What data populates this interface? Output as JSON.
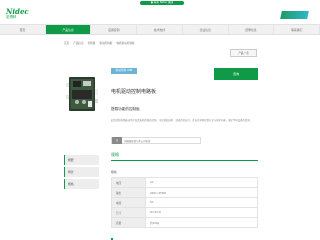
{
  "brand": {
    "name": "Nidec",
    "sub": "尼得科"
  },
  "header": {
    "pill_text": "● 联系 Nidec 集团"
  },
  "nav": {
    "items": [
      "首页",
      "产品信息",
      "应用实例",
      "技术支持",
      "企业信息",
      "招聘信息",
      "联系我们"
    ],
    "active_index": 1
  },
  "breadcrumb": [
    "首页",
    "产品信息",
    "控制器",
    "驱动控制板",
    "电机驱动控制板"
  ],
  "top_button": "产品一览",
  "product": {
    "tag": "驱动控制 LMB",
    "cta": "咨询",
    "title": "电机驱动控制电路板",
    "subtitle": "搭载功能的控制板",
    "description": "此款控制电路板适用于各类电机的驱动控制，可实现高效率、低噪音的运行，并支持多种控制方式与保护功能，满足不同设备的需求。",
    "note_badge": "注",
    "note_text": "详细规格请与本公司咨询"
  },
  "sidebar": {
    "items": [
      "概要",
      "特长",
      "规格"
    ]
  },
  "spec": {
    "section_title": "规格",
    "subtitle": "规格",
    "rows": [
      {
        "key": "电压",
        "value": "AC"
      },
      {
        "key": "输出",
        "value": "20W～250W"
      },
      {
        "key": "电流",
        "value": "5A"
      },
      {
        "key": "尺寸",
        "value": "W×D×H"
      },
      {
        "key": "质量",
        "value": "约100g"
      }
    ]
  },
  "colors": {
    "brand_green": "#0e9a46",
    "tag_blue": "#6db3d6"
  }
}
